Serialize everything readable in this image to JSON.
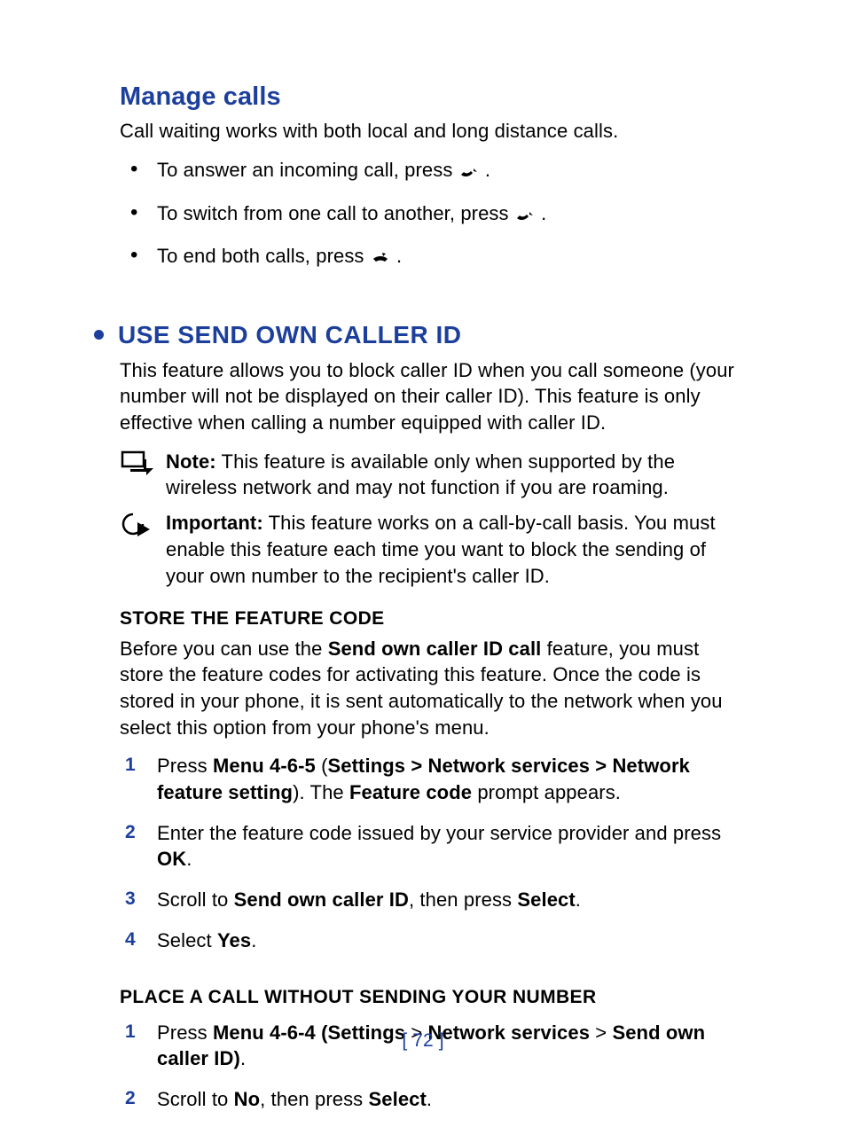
{
  "sections": {
    "manage_calls": {
      "title": "Manage calls",
      "intro": "Call waiting works with both local and long distance calls.",
      "bullets": {
        "b1_pre": "To answer an incoming call, press ",
        "b1_post": ".",
        "b2_pre": "To switch from one call to another, press ",
        "b2_post": ".",
        "b3_pre": "To end both calls, press ",
        "b3_post": "."
      }
    },
    "caller_id": {
      "title": "USE SEND OWN CALLER ID",
      "intro": "This feature allows you to block caller ID when you call someone (your number will not be displayed on their caller ID). This feature is only effective when calling a number equipped with caller ID.",
      "note_label": "Note:",
      "note_body": "This feature is available only when supported by the wireless network and may not function if you are roaming.",
      "important_label": "Important:",
      "important_body": "This feature works on a call-by-call basis. You must enable this feature each time you want to block the sending of your own number to the recipient's caller ID.",
      "store_code": {
        "title": "STORE THE FEATURE CODE",
        "intro_pre": "Before you can use the ",
        "intro_bold": "Send own caller ID call",
        "intro_post": " feature, you must store the feature codes for activating this feature. Once the code is stored in your phone, it is sent automatically to the network when you select this option from your phone's menu.",
        "steps": {
          "s1_pre": "Press ",
          "s1_b1": "Menu 4-6-5",
          "s1_mid1": " (",
          "s1_b2": "Settings > Network services > Network feature setting",
          "s1_mid2": "). The ",
          "s1_b3": "Feature code",
          "s1_post": " prompt appears.",
          "s2_pre": "Enter the feature code issued by your service provider and press ",
          "s2_b1": "OK",
          "s2_post": ".",
          "s3_pre": "Scroll to ",
          "s3_b1": "Send own caller ID",
          "s3_mid": ", then press ",
          "s3_b2": "Select",
          "s3_post": ".",
          "s4_pre": "Select ",
          "s4_b1": "Yes",
          "s4_post": "."
        }
      },
      "place_call": {
        "title": "PLACE A CALL WITHOUT SENDING YOUR NUMBER",
        "steps": {
          "s1_pre": "Press ",
          "s1_b1": "Menu 4-6-4 (Settings",
          "s1_mid1": " > ",
          "s1_b2": "Network services",
          "s1_mid2": " > ",
          "s1_b3": "Send own caller ID)",
          "s1_post": ".",
          "s2_pre": "Scroll to ",
          "s2_b1": "No",
          "s2_mid": ", then press ",
          "s2_b2": "Select",
          "s2_post": "."
        }
      }
    }
  },
  "page_number": "[ 72 ]"
}
